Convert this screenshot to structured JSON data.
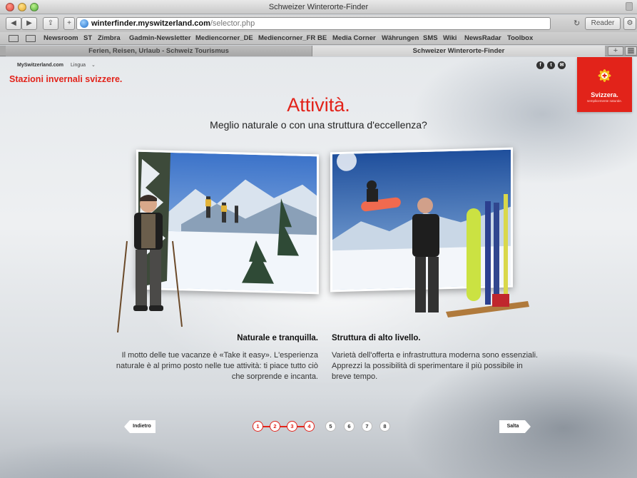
{
  "window": {
    "title": "Schweizer Winterorte-Finder"
  },
  "toolbar": {
    "url_host": "winterfinder.myswitzerland.com",
    "url_path": "/selector.php",
    "reader_label": "Reader"
  },
  "bookmarks": [
    "Newsroom",
    "ST",
    "Zimbra",
    "Gadmin-Newsletter",
    "Mediencorner_DE",
    "Mediencorner_FR",
    "BE",
    "Media Corner",
    "Währungen",
    "SMS",
    "Wiki",
    "NewsRadar",
    "Toolbox"
  ],
  "tabs": [
    {
      "label": "Ferien, Reisen, Urlaub - Schweiz Tourismus",
      "active": false
    },
    {
      "label": "Schweizer Winterorte-Finder",
      "active": true
    }
  ],
  "site": {
    "logo_text": "MySwitzerland.com",
    "language_label": "Lingua",
    "subtitle": "Stazioni invernali svizzere.",
    "brand_name": "Svizzera.",
    "brand_tagline": "semplicemente naturale.",
    "social": [
      "f",
      "t",
      "✉"
    ]
  },
  "main": {
    "title": "Attività.",
    "question": "Meglio naturale o con una struttura d'eccellenza?",
    "options": [
      {
        "heading": "Naturale e tranquilla.",
        "body": "Il motto delle tue vacanze è «Take it easy». L'esperienza naturale è al primo posto nelle tue attività: ti piace tutto ciò che sorprende e incanta."
      },
      {
        "heading": "Struttura di alto livello.",
        "body": "Varietà dell'offerta e infrastruttura moderna sono essenziali. Apprezzi la possibilità di sperimentare il più possibile in breve tempo."
      }
    ]
  },
  "navigation": {
    "back_label": "Indietro",
    "skip_label": "Salta",
    "steps": [
      "1",
      "2",
      "3",
      "4",
      "5",
      "6",
      "7",
      "8"
    ],
    "completed_steps": 4
  },
  "colors": {
    "accent_red": "#e2231a"
  }
}
